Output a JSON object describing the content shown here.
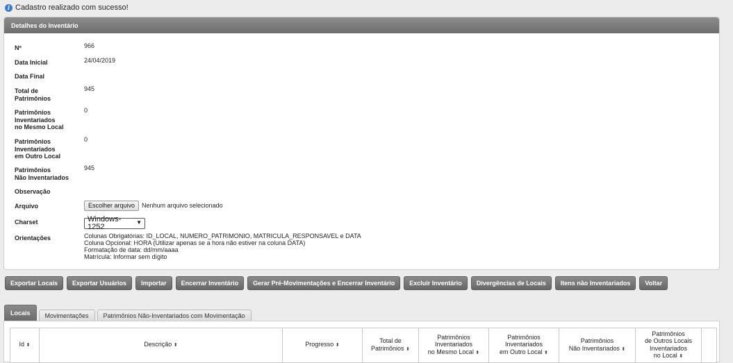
{
  "message": {
    "text": "Cadastro realizado com sucesso!"
  },
  "panel": {
    "title": "Detalhes do Inventário",
    "fields": {
      "numero": {
        "label": "Nº",
        "value": "966"
      },
      "data_inicial": {
        "label": "Data Inicial",
        "value": "24/04/2019"
      },
      "data_final": {
        "label": "Data Final",
        "value": ""
      },
      "total": {
        "label": "Total de\nPatrimônios",
        "value": "945"
      },
      "mesmo_local": {
        "label": "Patrimônios\nInventariados\nno Mesmo Local",
        "value": "0"
      },
      "outro_local": {
        "label": "Patrimônios\nInventariados\nem Outro Local",
        "value": "0"
      },
      "nao_inventariados": {
        "label": "Patrimônios\nNão Inventariados",
        "value": "945"
      },
      "observacao": {
        "label": "Observação",
        "value": ""
      },
      "arquivo": {
        "label": "Arquivo",
        "button": "Escolher arquivo",
        "status": "Nenhum arquivo selecionado"
      },
      "charset": {
        "label": "Charset",
        "selected": "Windows-1252"
      },
      "orientacoes": {
        "label": "Orientações",
        "lines": [
          "Colunas Obrigatórias: ID_LOCAL, NUMERO_PATRIMONIO, MATRICULA_RESPONSAVEL e DATA",
          "Coluna Opcional: HORA (Utilizar apenas se a hora não estiver na coluna DATA)",
          "Formatação de data: dd/mm/aaaa",
          "Matrícula: Informar sem dígito"
        ]
      }
    }
  },
  "toolbar": {
    "exportar_locais": "Exportar Locais",
    "exportar_usuarios": "Exportar Usuários",
    "importar": "Importar",
    "encerrar": "Encerrar Inventário",
    "gerar": "Gerar Pré-Movimentações e Encerrar Inventário",
    "excluir": "Excluir Inventário",
    "divergencias": "Divergências de Locais",
    "itens_nao": "Itens não Inventariados",
    "voltar": "Voltar"
  },
  "tabs": {
    "locais": "Locais",
    "movimentacoes": "Movimentações",
    "patrimonios_nao": "Patrimônios Não-Inventariados com Movimentação"
  },
  "table": {
    "sort_glyph": "⬍",
    "columns": [
      "Id",
      "Descrição",
      "Progresso",
      "Total de\nPatrimônios",
      "Patrimônios\nInventariados\nno Mesmo Local",
      "Patrimônios\nInventariados\nem Outro Local",
      "Patrimônios\nNão Inventariados",
      "Patrimônios\nde Outros Locais\nInventariados\nno Local"
    ]
  }
}
